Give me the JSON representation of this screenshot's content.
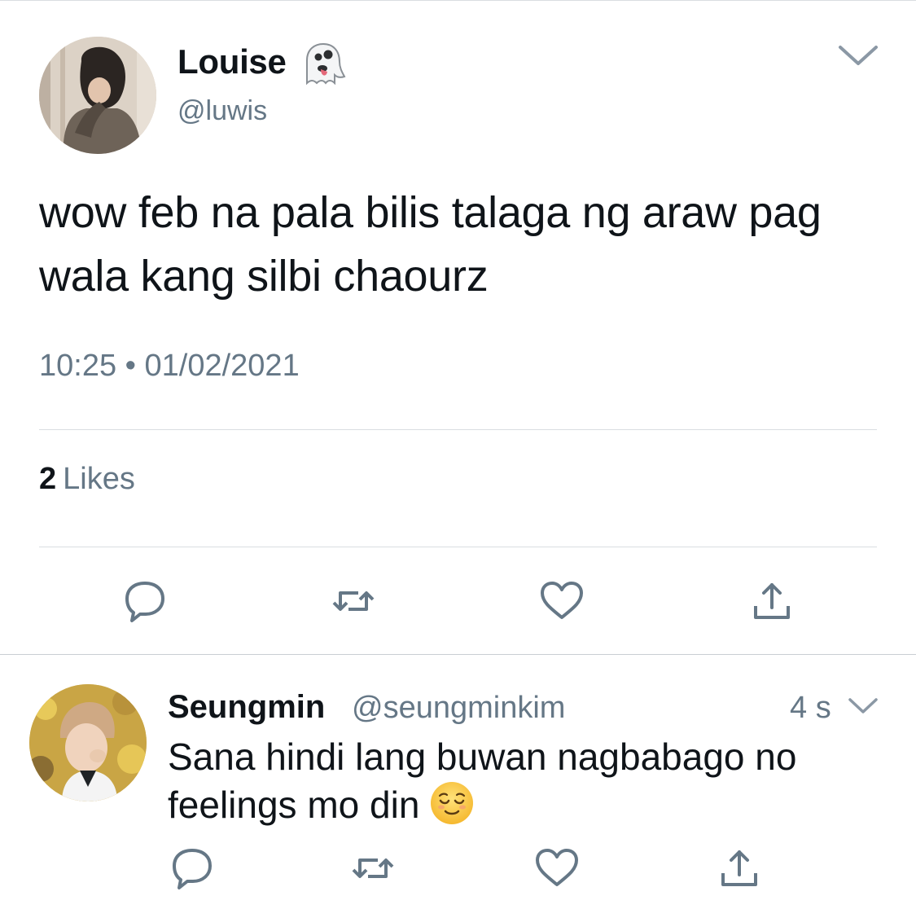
{
  "tweet": {
    "author": {
      "name": "Louise",
      "handle": "@luwis",
      "name_emoji": "ghost-emoji"
    },
    "text": "wow feb na pala bilis talaga ng araw pag wala kang silbi chaourz",
    "timestamp": "10:25 • 01/02/2021",
    "likes_count": "2",
    "likes_label": "Likes",
    "actions": [
      "reply-icon",
      "retweet-icon",
      "like-icon",
      "share-icon"
    ]
  },
  "reply": {
    "author": {
      "name": "Seungmin",
      "handle": "@seungminkim"
    },
    "time": "4 s",
    "text": "Sana hindi lang buwan nagbabago no feelings mo din",
    "emoji": "relieved-face-emoji",
    "actions": [
      "reply-icon",
      "retweet-icon",
      "like-icon",
      "share-icon"
    ]
  },
  "colors": {
    "text": "#0f1419",
    "secondary": "#657786",
    "divider": "#d9dde1",
    "icon": "#657786"
  }
}
